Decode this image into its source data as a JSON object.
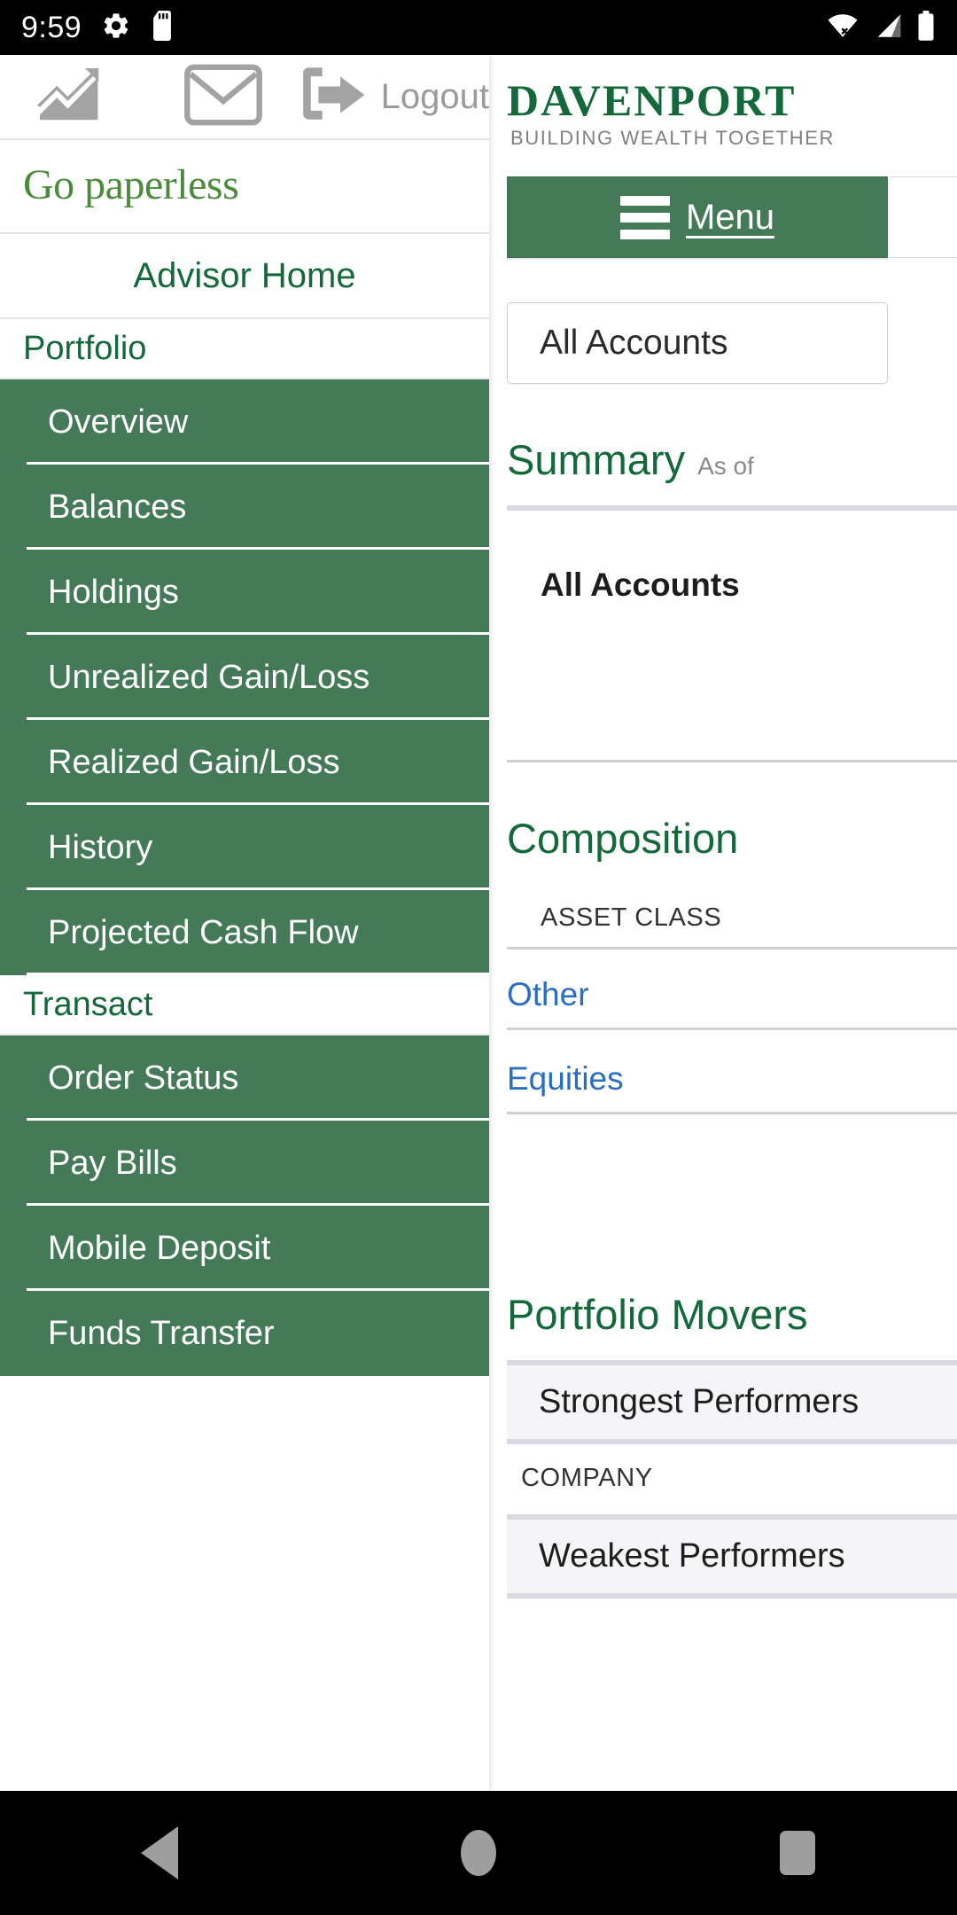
{
  "statusbar": {
    "time": "9:59",
    "icons_left": [
      "gear-icon",
      "sd-card-icon"
    ],
    "icons_right": [
      "wifi-off-icon",
      "cell-signal-icon",
      "battery-icon"
    ]
  },
  "background_page": {
    "brand": {
      "name": "DAVENPORT",
      "tagline": "BUILDING WEALTH TOGETHER"
    },
    "menu_button": {
      "label": "Menu"
    },
    "account_select": {
      "value": "All Accounts"
    },
    "summary": {
      "title": "Summary",
      "subtitle": "As of",
      "account_label": "All Accounts"
    },
    "composition": {
      "title": "Composition",
      "column_header": "ASSET CLASS",
      "rows": [
        "Other",
        "Equities"
      ]
    },
    "movers": {
      "title": "Portfolio Movers",
      "strongest_label": "Strongest Performers",
      "company_header": "COMPANY",
      "weakest_label": "Weakest Performers"
    }
  },
  "drawer": {
    "toolbar": {
      "chart_icon": "trending-chart-icon",
      "mail_icon": "envelope-icon",
      "logout_icon": "logout-arrow-icon",
      "logout_label": "Logout"
    },
    "paperless_label": "Go paperless",
    "advisor_home_label": "Advisor Home",
    "groups": [
      {
        "label": "Portfolio",
        "items": [
          "Overview",
          "Balances",
          "Holdings",
          "Unrealized Gain/Loss",
          "Realized Gain/Loss",
          "History",
          "Projected Cash Flow"
        ]
      },
      {
        "label": "Transact",
        "items": [
          "Order Status",
          "Pay Bills",
          "Mobile Deposit",
          "Funds Transfer"
        ]
      }
    ]
  },
  "navbar": {
    "back": "back-triangle-icon",
    "home": "home-circle-icon",
    "recents": "recents-square-icon"
  },
  "colors": {
    "brand_green": "#14693a",
    "nav_green": "#447a57",
    "link_blue": "#2a6ec4",
    "paperless_green": "#4d8b3c"
  }
}
